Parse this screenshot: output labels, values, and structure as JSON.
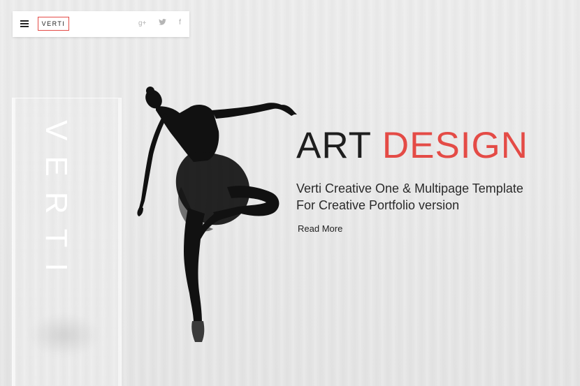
{
  "header": {
    "logo_text": "VERTI",
    "menu_icon": "hamburger-menu-icon",
    "social": [
      {
        "name": "google-plus-icon",
        "glyph": "g+"
      },
      {
        "name": "twitter-icon",
        "glyph": "❧"
      },
      {
        "name": "facebook-icon",
        "glyph": "f"
      }
    ]
  },
  "side_panel": {
    "vertical_text": "VERTI"
  },
  "hero": {
    "title_main": "ART",
    "title_accent": "DESIGN",
    "subtitle_line1": "Verti Creative One & Multipage Template",
    "subtitle_line2": "For Creative Portfolio version",
    "cta_label": "Read More"
  },
  "colors": {
    "accent": "#e44b46",
    "background": "#e8e8e8",
    "text": "#1e1e1e"
  }
}
